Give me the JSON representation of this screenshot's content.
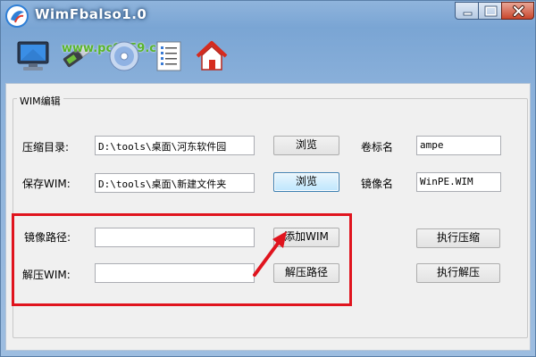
{
  "window": {
    "title": "WimFbalso1.0",
    "controls": [
      "minimize-icon",
      "maximize-icon",
      "close-icon"
    ]
  },
  "toolbar": {
    "icons": [
      "monitor-icon",
      "usb-drive-icon",
      "disc-icon",
      "document-icon",
      "home-icon"
    ],
    "watermark": "www.pc0359.cn"
  },
  "group": {
    "title": "WIM编辑"
  },
  "form": {
    "compress_dir": {
      "label": "压缩目录:",
      "value": "D:\\tools\\桌面\\河东软件园"
    },
    "save_wim": {
      "label": "保存WIM:",
      "value": "D:\\tools\\桌面\\新建文件夹"
    },
    "browse_label": "浏览",
    "volume_name": {
      "label": "卷标名",
      "value": "ampe"
    },
    "image_name": {
      "label": "镜像名",
      "value": "WinPE.WIM"
    },
    "image_path": {
      "label": "镜像路径:",
      "value": ""
    },
    "extract_wim": {
      "label": "解压WIM:",
      "value": ""
    },
    "add_wim_label": "添加WIM",
    "extract_path_label": "解压路径",
    "run_compress_label": "执行压缩",
    "run_extract_label": "执行解压"
  },
  "colors": {
    "highlight": "#e0141e",
    "title_text": "#ffffff",
    "watermark": "#59b52a"
  }
}
